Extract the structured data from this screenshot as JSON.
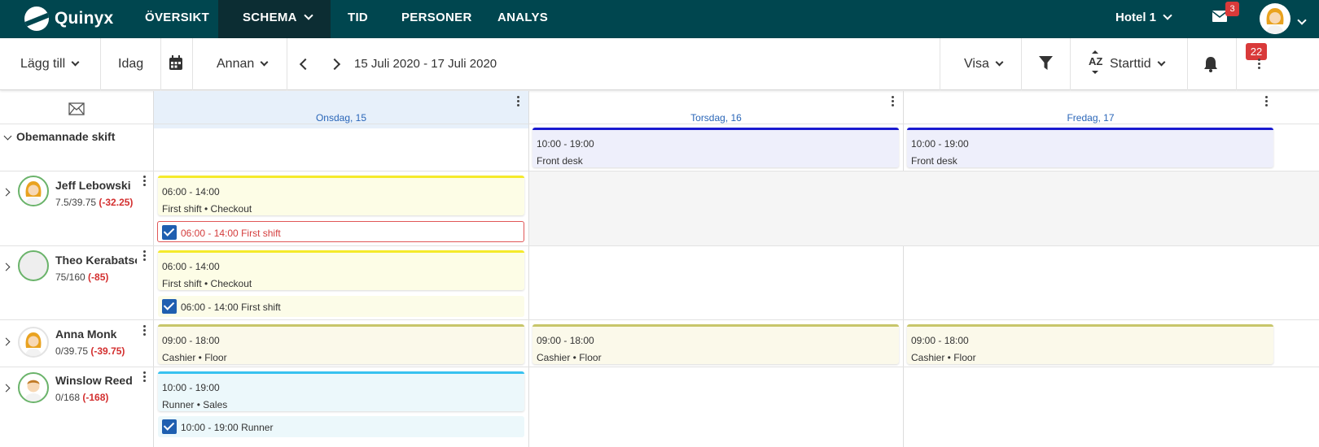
{
  "topnav": {
    "logo_text": "Quinyx",
    "items": [
      {
        "label": "ÖVERSIKT"
      },
      {
        "label": "SCHEMA",
        "active": true
      },
      {
        "label": "TID"
      },
      {
        "label": "PERSONER"
      },
      {
        "label": "ANALYS"
      }
    ],
    "hotel": "Hotel 1",
    "mail_badge": "3",
    "colors": {
      "nav_bg": "#00464f",
      "active_bg": "#0c2d33",
      "badge": "#d93a3a"
    }
  },
  "toolbar": {
    "add_label": "Lägg till",
    "today_label": "Idag",
    "other_label": "Annan",
    "date_range": "15 Juli 2020 - 17 Juli 2020",
    "show_label": "Visa",
    "sort_label": "Starttid",
    "sort_icon_text": "AZ",
    "bell_badge": "22"
  },
  "grid": {
    "days": [
      {
        "label": "Onsdag, 15",
        "today": true
      },
      {
        "label": "Torsdag, 16"
      },
      {
        "label": "Fredag, 17"
      }
    ],
    "unstaffed_label": "Obemannade skift",
    "unstaffed_shifts": [
      {
        "time": "10:00 - 19:00",
        "desc": "Front desk"
      },
      {
        "time": "10:00 - 19:00",
        "desc": "Front desk"
      }
    ],
    "employees": [
      {
        "name": "Jeff Lebowski",
        "hours": "7.5/39.75",
        "diff": "(-32.25)",
        "shift": {
          "time": "06:00 - 14:00",
          "desc": "First shift • Checkout"
        },
        "task": {
          "time": "06:00 - 14:00",
          "label": "First shift"
        }
      },
      {
        "name": "Theo Kerabatsos",
        "hours": "75/160",
        "diff": "(-85)",
        "shift": {
          "time": "06:00 - 14:00",
          "desc": "First shift • Checkout"
        },
        "task": {
          "time": "06:00 - 14:00",
          "label": "First shift"
        }
      },
      {
        "name": "Anna Monk",
        "hours": "0/39.75",
        "diff": "(-39.75)",
        "shifts": [
          {
            "time": "09:00 - 18:00",
            "desc": "Cashier • Floor"
          },
          {
            "time": "09:00 - 18:00",
            "desc": "Cashier • Floor"
          },
          {
            "time": "09:00 - 18:00",
            "desc": "Cashier • Floor"
          }
        ]
      },
      {
        "name": "Winslow Reed",
        "hours": "0/168",
        "diff": "(-168)",
        "shift": {
          "time": "10:00 - 19:00",
          "desc": "Runner • Sales"
        },
        "task": {
          "time": "10:00 - 19:00",
          "label": "Runner"
        }
      }
    ]
  }
}
